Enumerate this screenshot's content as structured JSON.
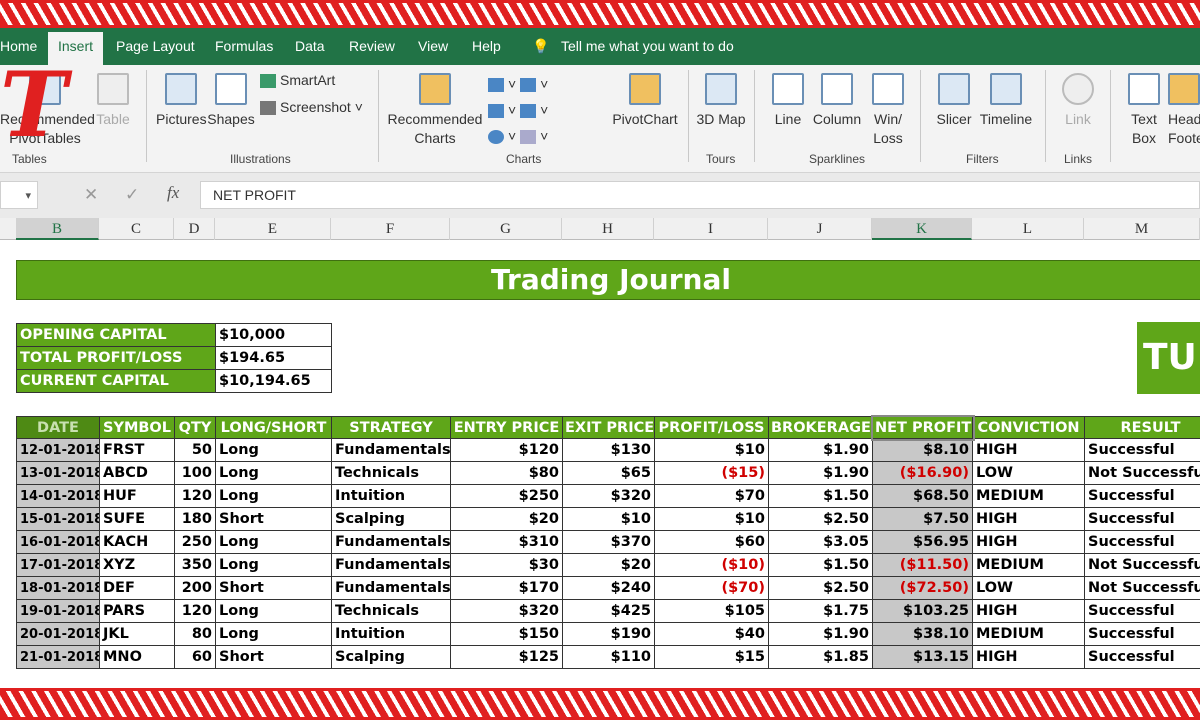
{
  "ribbon": {
    "tabs": [
      "Home",
      "Insert",
      "Page Layout",
      "Formulas",
      "Data",
      "Review",
      "View",
      "Help"
    ],
    "tell_me": "Tell me what you want to do",
    "buttons": {
      "rec_pivot": "Recommended PivotTables",
      "table": "Table",
      "pictures": "Pictures",
      "shapes": "Shapes",
      "smartart": "SmartArt",
      "screenshot": "Screenshot",
      "rec_charts": "Recommended Charts",
      "pivotchart": "PivotChart",
      "map3d": "3D Map",
      "line": "Line",
      "column": "Column",
      "winloss": "Win/ Loss",
      "slicer": "Slicer",
      "timeline": "Timeline",
      "link": "Link",
      "textbox": "Text Box",
      "header": "Header & Footer"
    },
    "groups": {
      "tables": "Tables",
      "illustrations": "Illustrations",
      "charts": "Charts",
      "tours": "Tours",
      "sparklines": "Sparklines",
      "filters": "Filters",
      "links": "Links"
    }
  },
  "formula_bar": {
    "value": "NET PROFIT"
  },
  "columns": [
    "B",
    "C",
    "D",
    "E",
    "F",
    "G",
    "H",
    "I",
    "J",
    "K",
    "L",
    "M"
  ],
  "sheet": {
    "title": "Trading Journal",
    "logo_text": "TU",
    "summary": [
      {
        "label": "OPENING CAPITAL",
        "value": "$10,000"
      },
      {
        "label": "TOTAL PROFIT/LOSS",
        "value": "$194.65"
      },
      {
        "label": "CURRENT CAPITAL",
        "value": "$10,194.65"
      }
    ],
    "headers": [
      "DATE",
      "SYMBOL",
      "QTY",
      "LONG/SHORT",
      "STRATEGY",
      "ENTRY PRICE",
      "EXIT PRICE",
      "PROFIT/LOSS",
      "BROKERAGE",
      "NET PROFIT",
      "CONVICTION",
      "RESULT"
    ],
    "rows": [
      [
        "12-01-2018",
        "FRST",
        "50",
        "Long",
        "Fundamentals",
        "$120",
        "$130",
        "$10",
        "$1.90",
        "$8.10",
        "HIGH",
        "Successful"
      ],
      [
        "13-01-2018",
        "ABCD",
        "100",
        "Long",
        "Technicals",
        "$80",
        "$65",
        "($15)",
        "$1.90",
        "($16.90)",
        "LOW",
        "Not Successful"
      ],
      [
        "14-01-2018",
        "HUF",
        "120",
        "Long",
        "Intuition",
        "$250",
        "$320",
        "$70",
        "$1.50",
        "$68.50",
        "MEDIUM",
        "Successful"
      ],
      [
        "15-01-2018",
        "SUFE",
        "180",
        "Short",
        "Scalping",
        "$20",
        "$10",
        "$10",
        "$2.50",
        "$7.50",
        "HIGH",
        "Successful"
      ],
      [
        "16-01-2018",
        "KACH",
        "250",
        "Long",
        "Fundamentals",
        "$310",
        "$370",
        "$60",
        "$3.05",
        "$56.95",
        "HIGH",
        "Successful"
      ],
      [
        "17-01-2018",
        "XYZ",
        "350",
        "Long",
        "Fundamentals",
        "$30",
        "$20",
        "($10)",
        "$1.50",
        "($11.50)",
        "MEDIUM",
        "Not Successful"
      ],
      [
        "18-01-2018",
        "DEF",
        "200",
        "Short",
        "Fundamentals",
        "$170",
        "$240",
        "($70)",
        "$2.50",
        "($72.50)",
        "LOW",
        "Not Successful"
      ],
      [
        "19-01-2018",
        "PARS",
        "120",
        "Long",
        "Technicals",
        "$320",
        "$425",
        "$105",
        "$1.75",
        "$103.25",
        "HIGH",
        "Successful"
      ],
      [
        "20-01-2018",
        "JKL",
        "80",
        "Long",
        "Intuition",
        "$150",
        "$190",
        "$40",
        "$1.90",
        "$38.10",
        "MEDIUM",
        "Successful"
      ],
      [
        "21-01-2018",
        "MNO",
        "60",
        "Short",
        "Scalping",
        "$125",
        "$110",
        "$15",
        "$1.85",
        "$13.15",
        "HIGH",
        "Successful"
      ]
    ]
  },
  "colors": {
    "excel_green": "#217346",
    "header_green": "#5fa619",
    "negative": "#d00000",
    "border_red": "#e02020"
  }
}
